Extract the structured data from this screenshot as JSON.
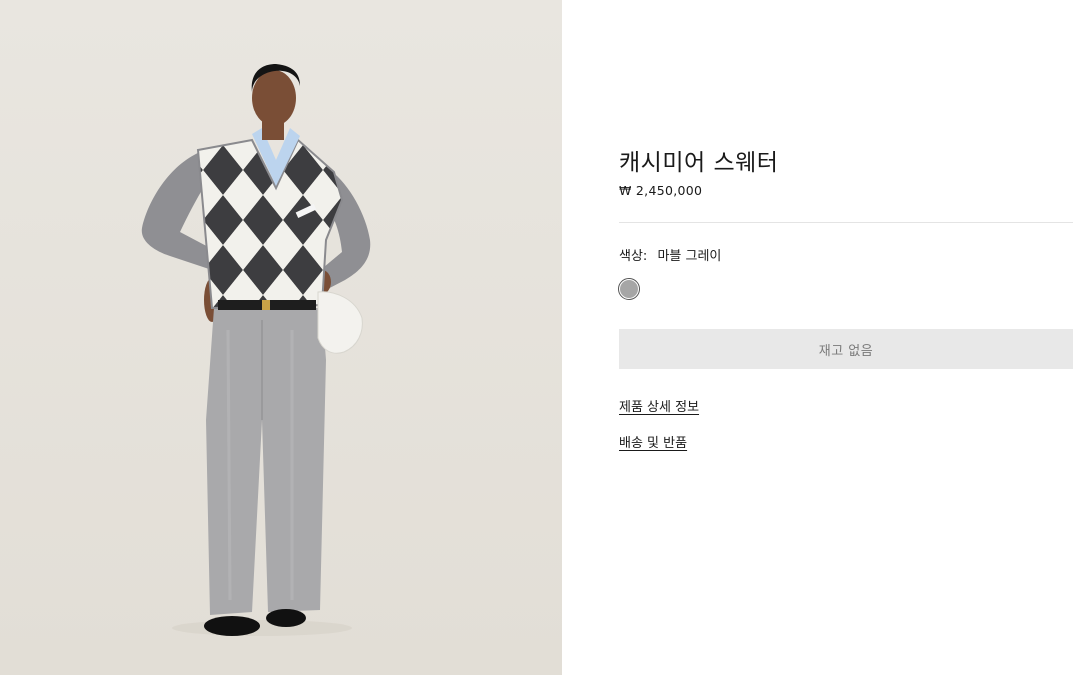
{
  "product": {
    "title": "캐시미어 스웨터",
    "price": "₩ 2,450,000"
  },
  "color": {
    "label": "색상:",
    "value": "마블 그레이",
    "swatch_hex": "#a6a6a6",
    "swatch_icon": "color-swatch-circle"
  },
  "actions": {
    "out_of_stock_label": "재고 없음"
  },
  "links": {
    "product_details": "제품 상세 정보",
    "shipping_returns": "배송 및 반품"
  },
  "colors": {
    "photo_background": "#e9e6e0",
    "button_background": "#e8e8e8",
    "button_text": "#7a7a7a"
  }
}
